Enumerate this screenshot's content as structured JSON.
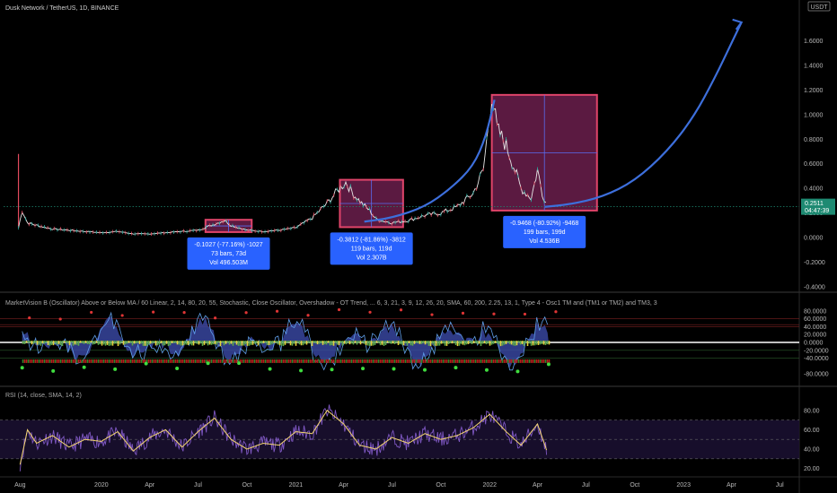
{
  "header": {
    "title": "Dusk Network / TetherUS, 1D, BINANCE",
    "currency": "USDT"
  },
  "colors": {
    "bg": "#000000",
    "price_line": "#e8e8e8",
    "price_candle": "#26a69a",
    "curve": "#3d6fdc",
    "box_fill": "#6b1e4c",
    "box_stroke": "#e0446a",
    "label_bg": "#2962ff",
    "price_tag": "#1e8a72",
    "rsi_line": "#7e57c2",
    "rsi_ma": "#f5d76e"
  },
  "chart_data": [
    {
      "type": "line",
      "name": "price",
      "x": [
        "2019-07-29",
        "2019-08-05",
        "2019-08-15",
        "2019-09-01",
        "2019-10-01",
        "2019-11-01",
        "2019-12-01",
        "2020-01-01",
        "2020-02-01",
        "2020-03-01",
        "2020-04-01",
        "2020-05-01",
        "2020-06-01",
        "2020-07-01",
        "2020-08-01",
        "2020-08-20",
        "2020-09-01",
        "2020-10-01",
        "2020-11-01",
        "2020-12-01",
        "2021-01-01",
        "2021-02-01",
        "2021-03-01",
        "2021-03-20",
        "2021-04-05",
        "2021-04-20",
        "2021-05-05",
        "2021-05-20",
        "2021-06-01",
        "2021-07-01",
        "2021-08-01",
        "2021-09-01",
        "2021-10-01",
        "2021-11-01",
        "2021-12-01",
        "2021-12-20",
        "2022-01-05",
        "2022-01-15",
        "2022-02-01",
        "2022-02-15",
        "2022-03-01",
        "2022-03-20",
        "2022-04-01",
        "2022-04-10",
        "2022-04-20"
      ],
      "values": [
        0.08,
        0.22,
        0.12,
        0.1,
        0.07,
        0.06,
        0.05,
        0.04,
        0.05,
        0.03,
        0.03,
        0.04,
        0.05,
        0.06,
        0.11,
        0.14,
        0.1,
        0.06,
        0.05,
        0.06,
        0.08,
        0.16,
        0.28,
        0.38,
        0.45,
        0.35,
        0.28,
        0.22,
        0.15,
        0.12,
        0.14,
        0.18,
        0.2,
        0.25,
        0.36,
        0.55,
        1.16,
        0.88,
        0.75,
        0.58,
        0.4,
        0.32,
        0.55,
        0.36,
        0.25
      ],
      "xlim": [
        "2019-07-01",
        "2023-07-31"
      ],
      "ylim": [
        -0.4,
        1.8
      ],
      "ticks_y": [
        "-0.4000",
        "-0.2000",
        "0.0000",
        "0.2000",
        "0.4000",
        "0.6000",
        "0.8000",
        "1.0000",
        "1.2000",
        "1.4000",
        "1.6000"
      ],
      "ticks_x": [
        "Aug",
        "2020",
        "Apr",
        "Jul",
        "Oct",
        "2021",
        "Apr",
        "Jul",
        "Oct",
        "2022",
        "Apr",
        "Jul",
        "Oct",
        "2023",
        "Apr",
        "Jul"
      ],
      "last_price": "0.2511",
      "countdown": "04:47:39",
      "grid": false,
      "annotations": [
        {
          "line1": "-0.1027 (-77.16%) -1027",
          "line2": "73 bars, 73d",
          "line3": "Vol 496.503M",
          "x0": "2020-07-15",
          "x1": "2020-10-10",
          "y0": 0.045,
          "y1": 0.145
        },
        {
          "line1": "-0.3812 (-81.86%) -3812",
          "line2": "119 bars, 119d",
          "line3": "Vol 2.307B",
          "x0": "2021-03-25",
          "x1": "2021-07-22",
          "y0": 0.085,
          "y1": 0.47
        },
        {
          "line1": "-0.9468 (-80.92%) -9468",
          "line2": "199 bars, 199d",
          "line3": "Vol 4.536B",
          "x0": "2022-01-05",
          "x1": "2022-07-22",
          "y0": 0.22,
          "y1": 1.16
        }
      ],
      "curve": {
        "x": [
          "2021-05-10",
          "2021-07-01",
          "2021-09-01",
          "2021-10-20",
          "2021-12-01",
          "2021-12-25",
          "2022-01-10"
        ],
        "values": [
          0.13,
          0.16,
          0.25,
          0.4,
          0.58,
          0.82,
          1.12
        ]
      },
      "curve2": {
        "x": [
          "2022-04-15",
          "2022-06-01",
          "2022-08-01",
          "2022-10-01",
          "2022-12-01",
          "2023-01-20",
          "2023-03-01",
          "2023-04-01",
          "2023-04-20"
        ],
        "values": [
          0.25,
          0.27,
          0.33,
          0.46,
          0.7,
          0.98,
          1.3,
          1.58,
          1.75
        ]
      }
    },
    {
      "type": "line",
      "name": "oscillator",
      "title": "MarketVision B (Oscillator) Above or Below MA / 60 Linear, 2, 14, 80, 20, 55, Stochastic, Close Oscillator, Overshadow - OT Trend, ... 6, 3, 21, 3, 9, 12, 26, 20, SMA, 60, 200, 2.25, 13, 1, Type 4 - Osc1 TM and (TM1 or TM2) and TM3, 3",
      "ylim": [
        -100,
        100
      ],
      "ticks_y": [
        "80.0000",
        "60.0000",
        "40.0000",
        "20.0000",
        "0.0000",
        "-20.0000",
        "-40.0000",
        "-80.0000"
      ]
    },
    {
      "type": "line",
      "name": "rsi",
      "title": "RSI (14, close, SMA, 14, 2)",
      "ylim": [
        15,
        90
      ],
      "ticks_y": [
        "80.00",
        "60.00",
        "40.00",
        "20.00"
      ],
      "levels": [
        70,
        50,
        30
      ],
      "x": [
        "2019-08-01",
        "2019-08-15",
        "2019-09-01",
        "2019-10-01",
        "2019-11-01",
        "2019-12-01",
        "2020-01-01",
        "2020-02-01",
        "2020-03-01",
        "2020-04-01",
        "2020-05-01",
        "2020-06-01",
        "2020-07-01",
        "2020-08-01",
        "2020-09-01",
        "2020-10-01",
        "2020-11-01",
        "2020-12-01",
        "2021-01-01",
        "2021-02-01",
        "2021-03-01",
        "2021-04-01",
        "2021-05-01",
        "2021-06-01",
        "2021-07-01",
        "2021-08-01",
        "2021-09-01",
        "2021-10-01",
        "2021-11-01",
        "2021-12-01",
        "2022-01-01",
        "2022-02-01",
        "2022-03-01",
        "2022-04-01",
        "2022-04-20"
      ],
      "values": [
        24,
        60,
        46,
        54,
        42,
        50,
        48,
        58,
        38,
        52,
        60,
        42,
        58,
        72,
        50,
        40,
        46,
        44,
        58,
        56,
        80,
        66,
        44,
        40,
        52,
        46,
        56,
        50,
        54,
        62,
        76,
        58,
        44,
        66,
        36
      ]
    }
  ]
}
